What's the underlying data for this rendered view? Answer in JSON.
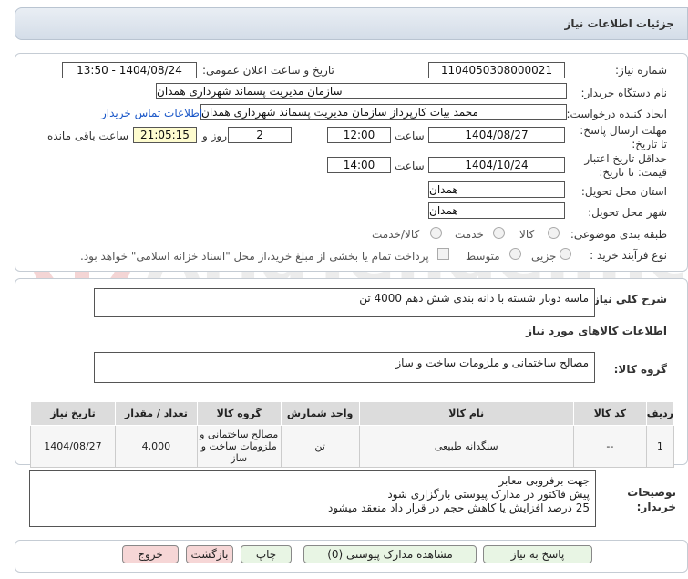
{
  "header": {
    "title": "جزئیات اطلاعات نیاز"
  },
  "form": {
    "need_number_label": "شماره نیاز:",
    "need_number": "1104050308000021",
    "announce_label": "تاریخ و ساعت اعلان عمومی:",
    "announce_value": "1404/08/24 - 13:50",
    "buyer_org_label": "نام دستگاه خریدار:",
    "buyer_org": "سازمان مدیریت پسماند شهرداری همدان",
    "requester_label": "ایجاد کننده درخواست:",
    "requester": "محمد بیات کارپرداز سازمان مدیریت پسماند شهرداری همدان",
    "contact_link": "اطلاعات تماس خریدار",
    "deadline_label": "مهلت ارسال پاسخ: تا تاریخ:",
    "deadline_date": "1404/08/27",
    "time_label": "ساعت",
    "deadline_time": "12:00",
    "days_value": "2",
    "days_label": "روز و",
    "remaining_time": "21:05:15",
    "remaining_label": "ساعت باقی مانده",
    "validity_label": "حداقل تاریخ اعتبار قیمت: تا تاریخ:",
    "validity_date": "1404/10/24",
    "validity_time": "14:00",
    "province_label": "استان محل تحویل:",
    "province": "همدان",
    "city_label": "شهر محل تحویل:",
    "city": "همدان",
    "category_label": "طبقه بندی موضوعی:",
    "category_options": [
      "کالا",
      "خدمت",
      "کالا/خدمت"
    ],
    "process_label": "نوع فرآیند خرید :",
    "process_options": [
      "جزیی",
      "متوسط"
    ],
    "payment_note": "پرداخت تمام یا بخشی از مبلغ خرید،از محل \"اسناد خزانه اسلامی\" خواهد بود."
  },
  "description": {
    "label": "شرح کلی نیاز:",
    "value": "ماسه دوبار شسته با دانه بندی شش دهم 4000 تن"
  },
  "goods": {
    "section_title": "اطلاعات کالاهای مورد نیاز",
    "group_label": "گروه کالا:",
    "group_value": "مصالح ساختمانی و ملزومات ساخت و ساز",
    "columns": [
      "ردیف",
      "کد کالا",
      "نام کالا",
      "واحد شمارش",
      "گروه کالا",
      "تعداد / مقدار",
      "تاریخ نیاز"
    ],
    "rows": [
      {
        "row": "1",
        "code": "--",
        "name": "سنگدانه طبیعی",
        "unit": "تن",
        "group": "مصالح ساختمانی و ملزومات ساخت و ساز",
        "qty": "4,000",
        "date": "1404/08/27"
      }
    ]
  },
  "buyer_notes": {
    "label": "توضیحات خریدار:",
    "lines": [
      "جهت برفروبی معابر",
      "پیش فاکتور در مدارک پیوستی بارگزاری شود",
      "25 درصد افزایش یا کاهش حجم در قرار داد منعقد میشود"
    ]
  },
  "buttons": {
    "reply": "پاسخ به نیاز",
    "attachments": "مشاهده مدارک پیوستی (0)",
    "print": "چاپ",
    "back": "بازگشت",
    "exit": "خروج"
  },
  "colors": {
    "accent_link": "#1a57c8",
    "green_button": "#e8f5e4",
    "red_button": "#f6d6d6",
    "highlight": "#fefccf"
  }
}
